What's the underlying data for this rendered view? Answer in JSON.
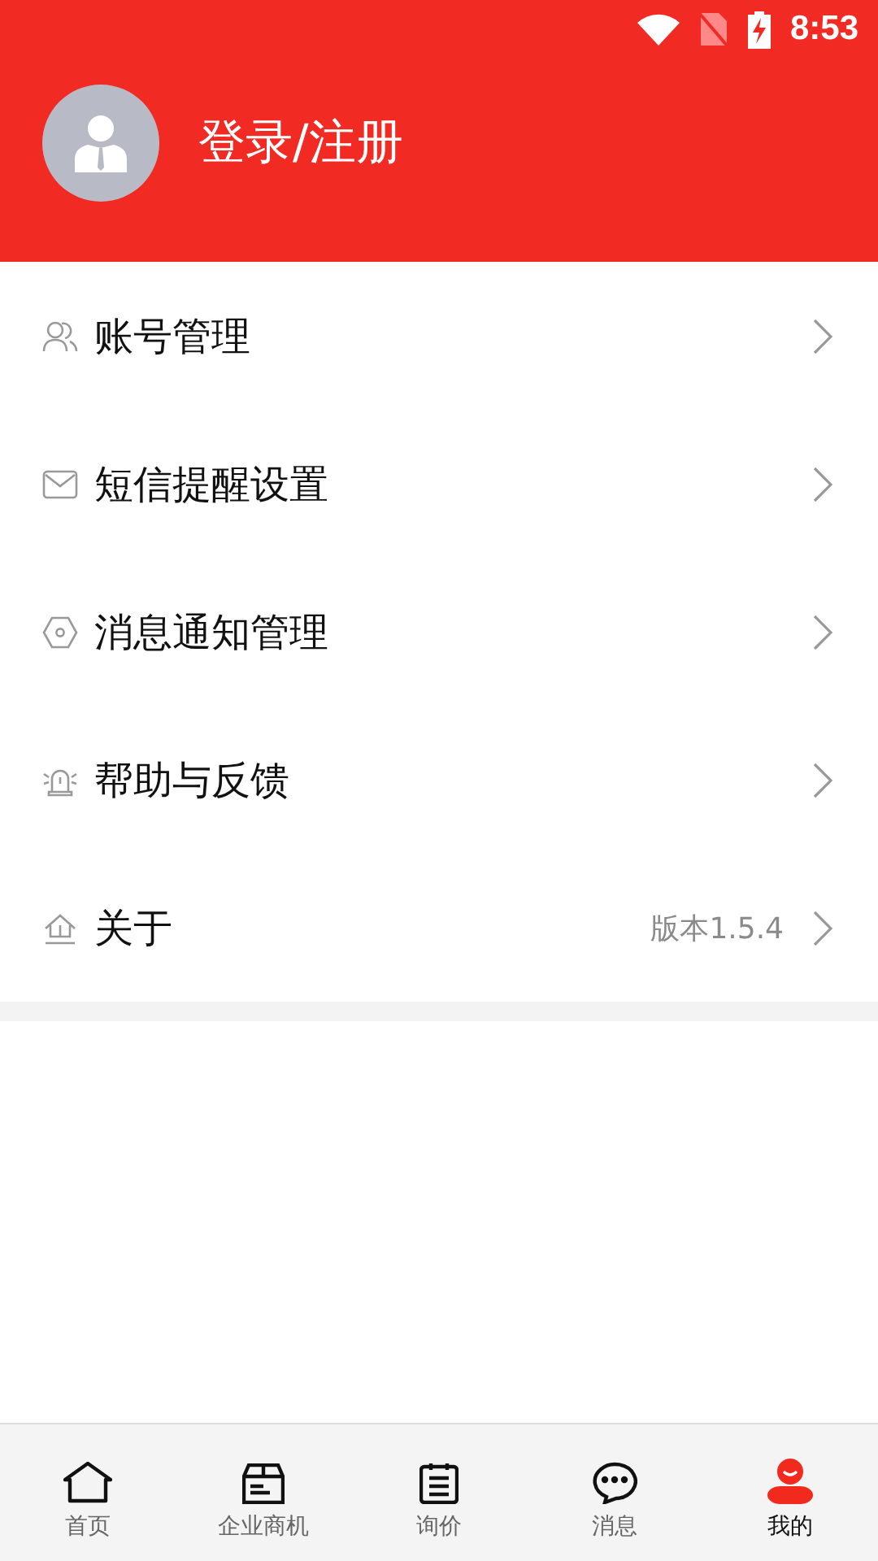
{
  "status_bar": {
    "time": "8:53"
  },
  "header": {
    "login_label": "登录/注册"
  },
  "menu": [
    {
      "kind": "people",
      "label": "账号管理"
    },
    {
      "kind": "mail",
      "label": "短信提醒设置"
    },
    {
      "kind": "hexagon",
      "label": "消息通知管理"
    },
    {
      "kind": "alarm",
      "label": "帮助与反馈"
    },
    {
      "kind": "home",
      "label": "关于",
      "detail": "版本1.5.4"
    }
  ],
  "tabs": [
    {
      "kind": "home",
      "label": "首页",
      "selected": false
    },
    {
      "kind": "box",
      "label": "企业商机",
      "selected": false
    },
    {
      "kind": "clipboard",
      "label": "询价",
      "selected": false
    },
    {
      "kind": "chat",
      "label": "消息",
      "selected": false
    },
    {
      "kind": "person",
      "label": "我的",
      "selected": true
    }
  ]
}
